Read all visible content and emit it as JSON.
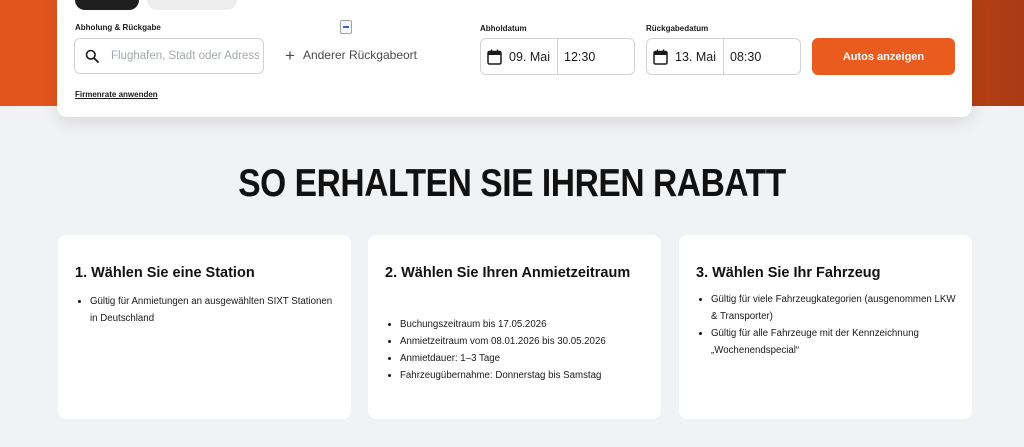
{
  "booking": {
    "pickup_label": "Abholung & Rückgabe",
    "location_placeholder": "Flughafen, Stadt oder Adresse",
    "other_return_label": "Anderer Rückgabeort",
    "pickup_date_label": "Abholdatum",
    "pickup_date": "09. Mai",
    "pickup_time": "12:30",
    "return_date_label": "Rückgabedatum",
    "return_date": "13. Mai",
    "return_time": "08:30",
    "cta_label": "Autos anzeigen",
    "company_rate_label": "Firmenrate anwenden"
  },
  "section": {
    "title": "SO ERHALTEN SIE IHREN RABATT"
  },
  "steps": [
    {
      "title": "1. Wählen Sie eine Station",
      "items": [
        "Gültig für Anmietungen an ausgewählten SIXT Stationen in Deutschland"
      ]
    },
    {
      "title": "2. Wählen Sie Ihren Anmietzeitraum",
      "items": [
        "Buchungszeitraum bis 17.05.2026",
        "Anmietzeitraum vom 08.01.2026 bis 30.05.2026",
        "Anmietdauer: 1–3 Tage",
        "Fahrzeugübernahme: Donnerstag bis Samstag"
      ]
    },
    {
      "title": "3. Wählen Sie Ihr Fahrzeug",
      "items": [
        "Gültig für viele Fahrzeugkategorien (ausgenommen LKW & Transporter)",
        "Gültig für alle Fahrzeuge mit der Kennzeichnung „Wochenendspecial“"
      ]
    }
  ],
  "colors": {
    "brand_orange": "#ea5b1f",
    "page_bg": "#f1f2f4"
  },
  "icons": {
    "search": "search-icon",
    "plus": "plus-icon",
    "calendar": "calendar-icon"
  }
}
